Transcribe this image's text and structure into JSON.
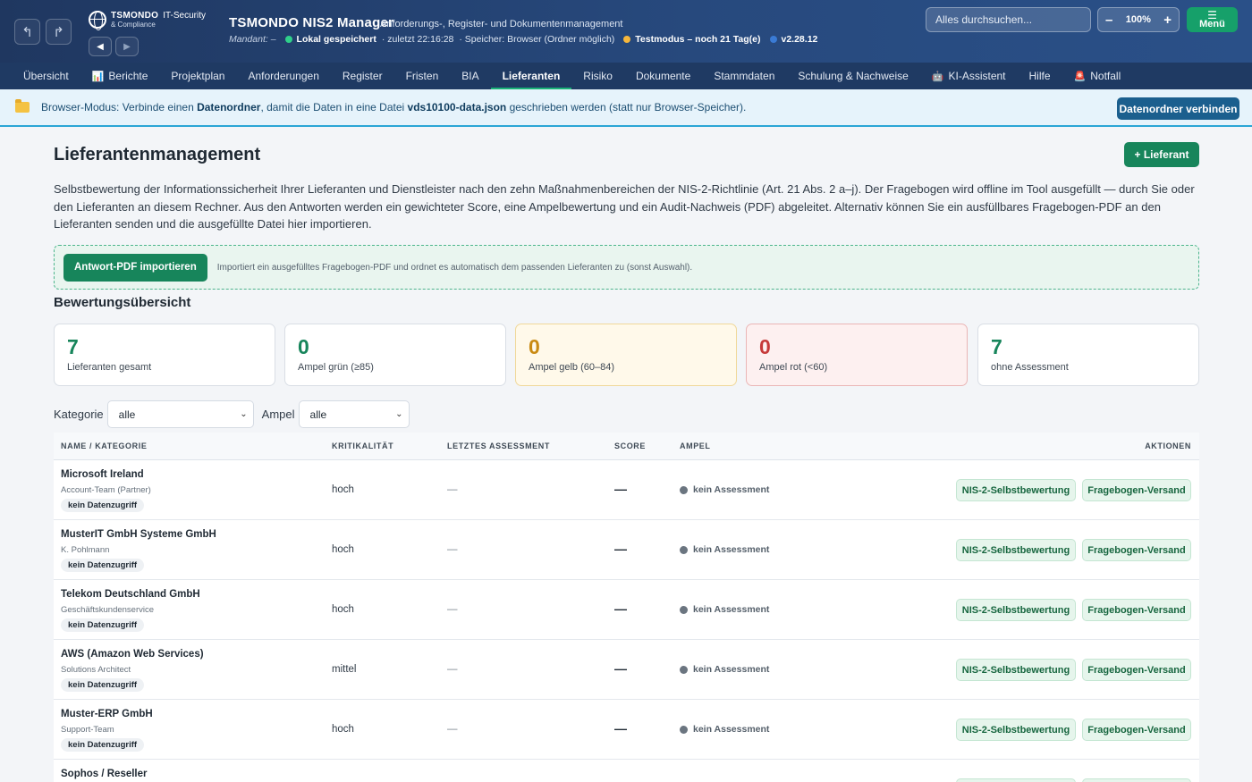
{
  "header": {
    "logo_name": "TSMONDO",
    "logo_it": "IT-Security",
    "logo_sub": "& Compliance",
    "app_title": "TSMONDO NIS2 Manager",
    "app_subtitle": "Anforderungs-, Register- und Dokumentenmanagement",
    "mandant": "Mandant: –",
    "status_saved": "Lokal gespeichert",
    "status_last": "· zuletzt 22:16:28",
    "status_storage": "· Speicher: Browser (Ordner möglich)",
    "status_test": "Testmodus – noch 21 Tag(e)",
    "version": "v2.28.12",
    "search_placeholder": "Alles durchsuchen...",
    "zoom_minus": "–",
    "zoom_value": "100%",
    "zoom_plus": "+",
    "menu_label": "Menü",
    "icons": {
      "undo": "undo-icon",
      "redo": "redo-icon",
      "back": "triangle-left-icon",
      "forward": "triangle-right-icon"
    },
    "colors": {
      "saved": "#2fd08a",
      "test": "#f6b73c",
      "version": "#3a7bd5"
    }
  },
  "tabs": [
    {
      "label": "Übersicht"
    },
    {
      "label": "Berichte",
      "icon": "📊"
    },
    {
      "label": "Projektplan"
    },
    {
      "label": "Anforderungen"
    },
    {
      "label": "Register"
    },
    {
      "label": "Fristen"
    },
    {
      "label": "BIA"
    },
    {
      "label": "Lieferanten",
      "active": true
    },
    {
      "label": "Risiko"
    },
    {
      "label": "Dokumente"
    },
    {
      "label": "Stammdaten"
    },
    {
      "label": "Schulung & Nachweise"
    },
    {
      "label": "KI-Assistent",
      "icon": "🤖"
    },
    {
      "label": "Hilfe"
    },
    {
      "label": "Notfall",
      "icon": "🚨"
    }
  ],
  "banner": {
    "text_1": "Browser-Modus: Verbinde einen ",
    "bold_1": "Datenordner",
    "text_2": ", damit die Daten in eine Datei ",
    "bold_2": "vds10100-data.json",
    "text_3": " geschrieben werden (statt nur Browser-Speicher).",
    "button": "Datenordner verbinden"
  },
  "main": {
    "title": "Lieferantenmanagement",
    "add_button": "+ Lieferant",
    "intro": "Selbstbewertung der Informationssicherheit Ihrer Lieferanten und Dienstleister nach den zehn Maßnahmenbereichen der NIS-2-Richtlinie (Art. 21 Abs. 2 a–j). Der Fragebogen wird offline im Tool ausgefüllt — durch Sie oder den Lieferanten an diesem Rechner. Aus den Antworten werden ein gewichteter Score, eine Ampelbewertung und ein Audit-Nachweis (PDF) abgeleitet. Alternativ können Sie ein ausfüllbares Fragebogen-PDF an den Lieferanten senden und die ausgefüllte Datei hier importieren.",
    "import_button": "Antwort-PDF importieren",
    "import_hint": "Importiert ein ausgefülltes Fragebogen-PDF und ordnet es automatisch dem passenden Lieferanten zu (sonst Auswahl).",
    "overview_title": "Bewertungsübersicht"
  },
  "kpis": [
    {
      "value": "7",
      "label": "Lieferanten gesamt",
      "color": "#17855b"
    },
    {
      "value": "0",
      "label": "Ampel grün (≥85)",
      "color": "#17855b"
    },
    {
      "value": "0",
      "label": "Ampel gelb (60–84)",
      "color": "#c98a12"
    },
    {
      "value": "0",
      "label": "Ampel rot (<60)",
      "color": "#c63a3a"
    },
    {
      "value": "7",
      "label": "ohne Assessment",
      "color": "#17855b"
    }
  ],
  "filters": {
    "category_label": "Kategorie",
    "category_value": "alle",
    "ampel_label": "Ampel",
    "ampel_value": "alle"
  },
  "table": {
    "headers": [
      "NAME / KATEGORIE",
      "KRITIKALITÄT",
      "LETZTES ASSESSMENT",
      "SCORE",
      "AMPEL",
      "AKTIONEN"
    ],
    "action_1": "NIS-2-Selbstbewertung",
    "action_2": "Fragebogen-Versand",
    "rows": [
      {
        "name": "Microsoft Ireland",
        "contact": "Account-Team (Partner)",
        "badge": "kein Datenzugriff",
        "crit": "hoch",
        "last": "—",
        "score": "—",
        "ampel": "kein Assessment"
      },
      {
        "name": "MusterIT GmbH Systeme GmbH",
        "contact": "K. Pohlmann",
        "badge": "kein Datenzugriff",
        "crit": "hoch",
        "last": "—",
        "score": "—",
        "ampel": "kein Assessment"
      },
      {
        "name": "Telekom Deutschland GmbH",
        "contact": "Geschäftskundenservice",
        "badge": "kein Datenzugriff",
        "crit": "hoch",
        "last": "—",
        "score": "—",
        "ampel": "kein Assessment"
      },
      {
        "name": "AWS (Amazon Web Services)",
        "contact": "Solutions Architect",
        "badge": "kein Datenzugriff",
        "crit": "mittel",
        "last": "—",
        "score": "—",
        "ampel": "kein Assessment"
      },
      {
        "name": "Muster-ERP GmbH",
        "contact": "Support-Team",
        "badge": "kein Datenzugriff",
        "crit": "hoch",
        "last": "—",
        "score": "—",
        "ampel": "kein Assessment"
      },
      {
        "name": "Sophos / Reseller",
        "contact": "",
        "badge": "",
        "crit": "",
        "last": "",
        "score": "",
        "ampel": ""
      }
    ]
  }
}
